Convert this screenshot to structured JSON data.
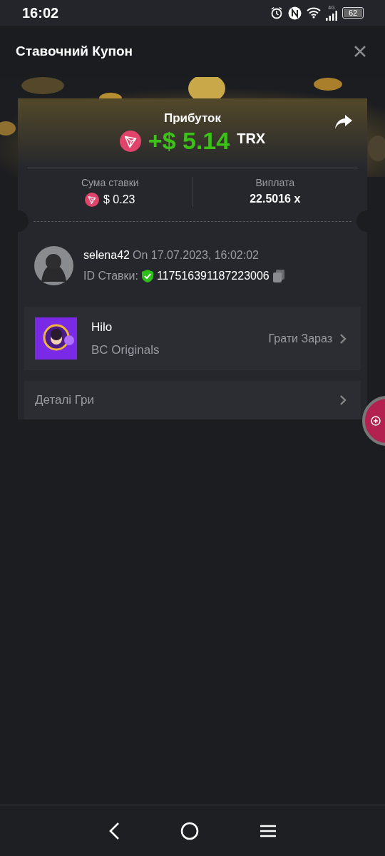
{
  "status_bar": {
    "time": "16:02",
    "network": "4G",
    "battery": "62"
  },
  "header": {
    "title": "Ставочний Купон"
  },
  "profit": {
    "label": "Прибуток",
    "amount": "+$ 5.14",
    "currency": "TRX"
  },
  "stats": [
    {
      "label": "Сума ставки",
      "value": "$ 0.23",
      "kind": "coin"
    },
    {
      "label": "Виплата",
      "value": "22.5016 x",
      "kind": "plain"
    }
  ],
  "bet": {
    "user": "selena42",
    "date": "On 17.07.2023, 16:02:02",
    "id_label": "ID Ставки:",
    "id": "117516391187223006",
    "verified": true
  },
  "game": {
    "name": "Hilo",
    "provider": "BC Originals",
    "action": "Грати Зараз"
  },
  "details": {
    "label": "Деталі Гри"
  }
}
